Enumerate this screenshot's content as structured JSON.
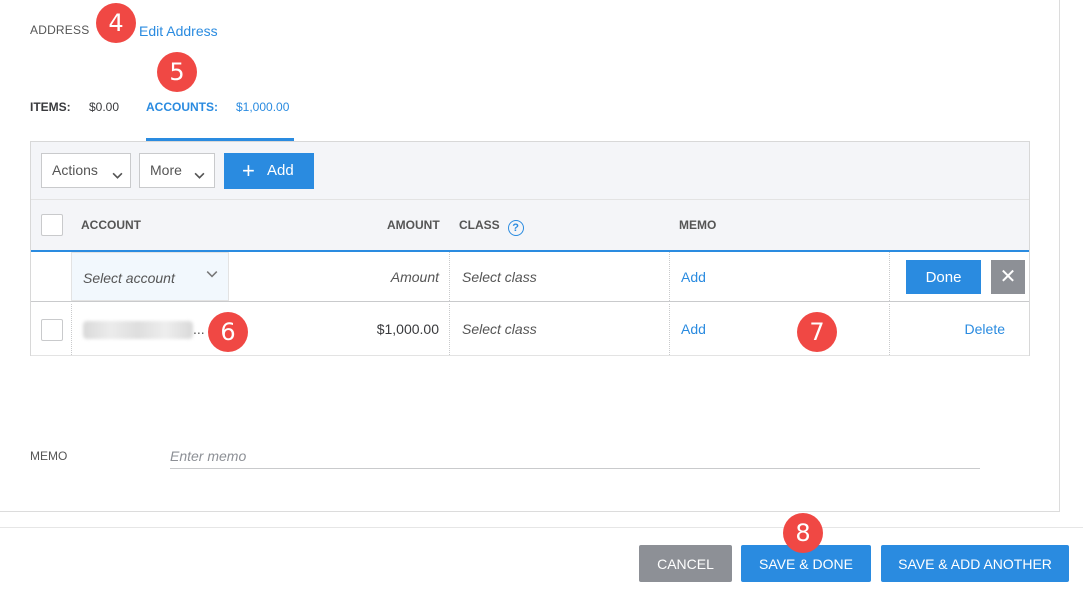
{
  "address": {
    "label": "ADDRESS",
    "edit_link": "Edit Address"
  },
  "badges": [
    "4",
    "5",
    "6",
    "7",
    "8"
  ],
  "totals": {
    "items_label": "ITEMS:",
    "items_value": "$0.00",
    "accounts_label": "ACCOUNTS:",
    "accounts_value": "$1,000.00"
  },
  "toolbar": {
    "actions": "Actions",
    "more": "More",
    "add": "Add"
  },
  "columns": {
    "account": "ACCOUNT",
    "amount": "AMOUNT",
    "class": "CLASS",
    "class_help": "?",
    "memo": "MEMO"
  },
  "edit_row": {
    "account_placeholder": "Select account",
    "amount_placeholder": "Amount",
    "class_placeholder": "Select class",
    "memo_link": "Add",
    "done": "Done",
    "close": "✕"
  },
  "data_row": {
    "account_suffix": "...",
    "amount": "$1,000.00",
    "class": "Select class",
    "memo_link": "Add",
    "delete": "Delete"
  },
  "memo": {
    "label": "MEMO",
    "placeholder": "Enter memo"
  },
  "footer": {
    "cancel": "CANCEL",
    "save_done": "SAVE & DONE",
    "save_add": "SAVE & ADD ANOTHER"
  },
  "colors": {
    "accent": "#2a8be0",
    "badge": "#f04844",
    "neutral_button": "#8d9096"
  }
}
